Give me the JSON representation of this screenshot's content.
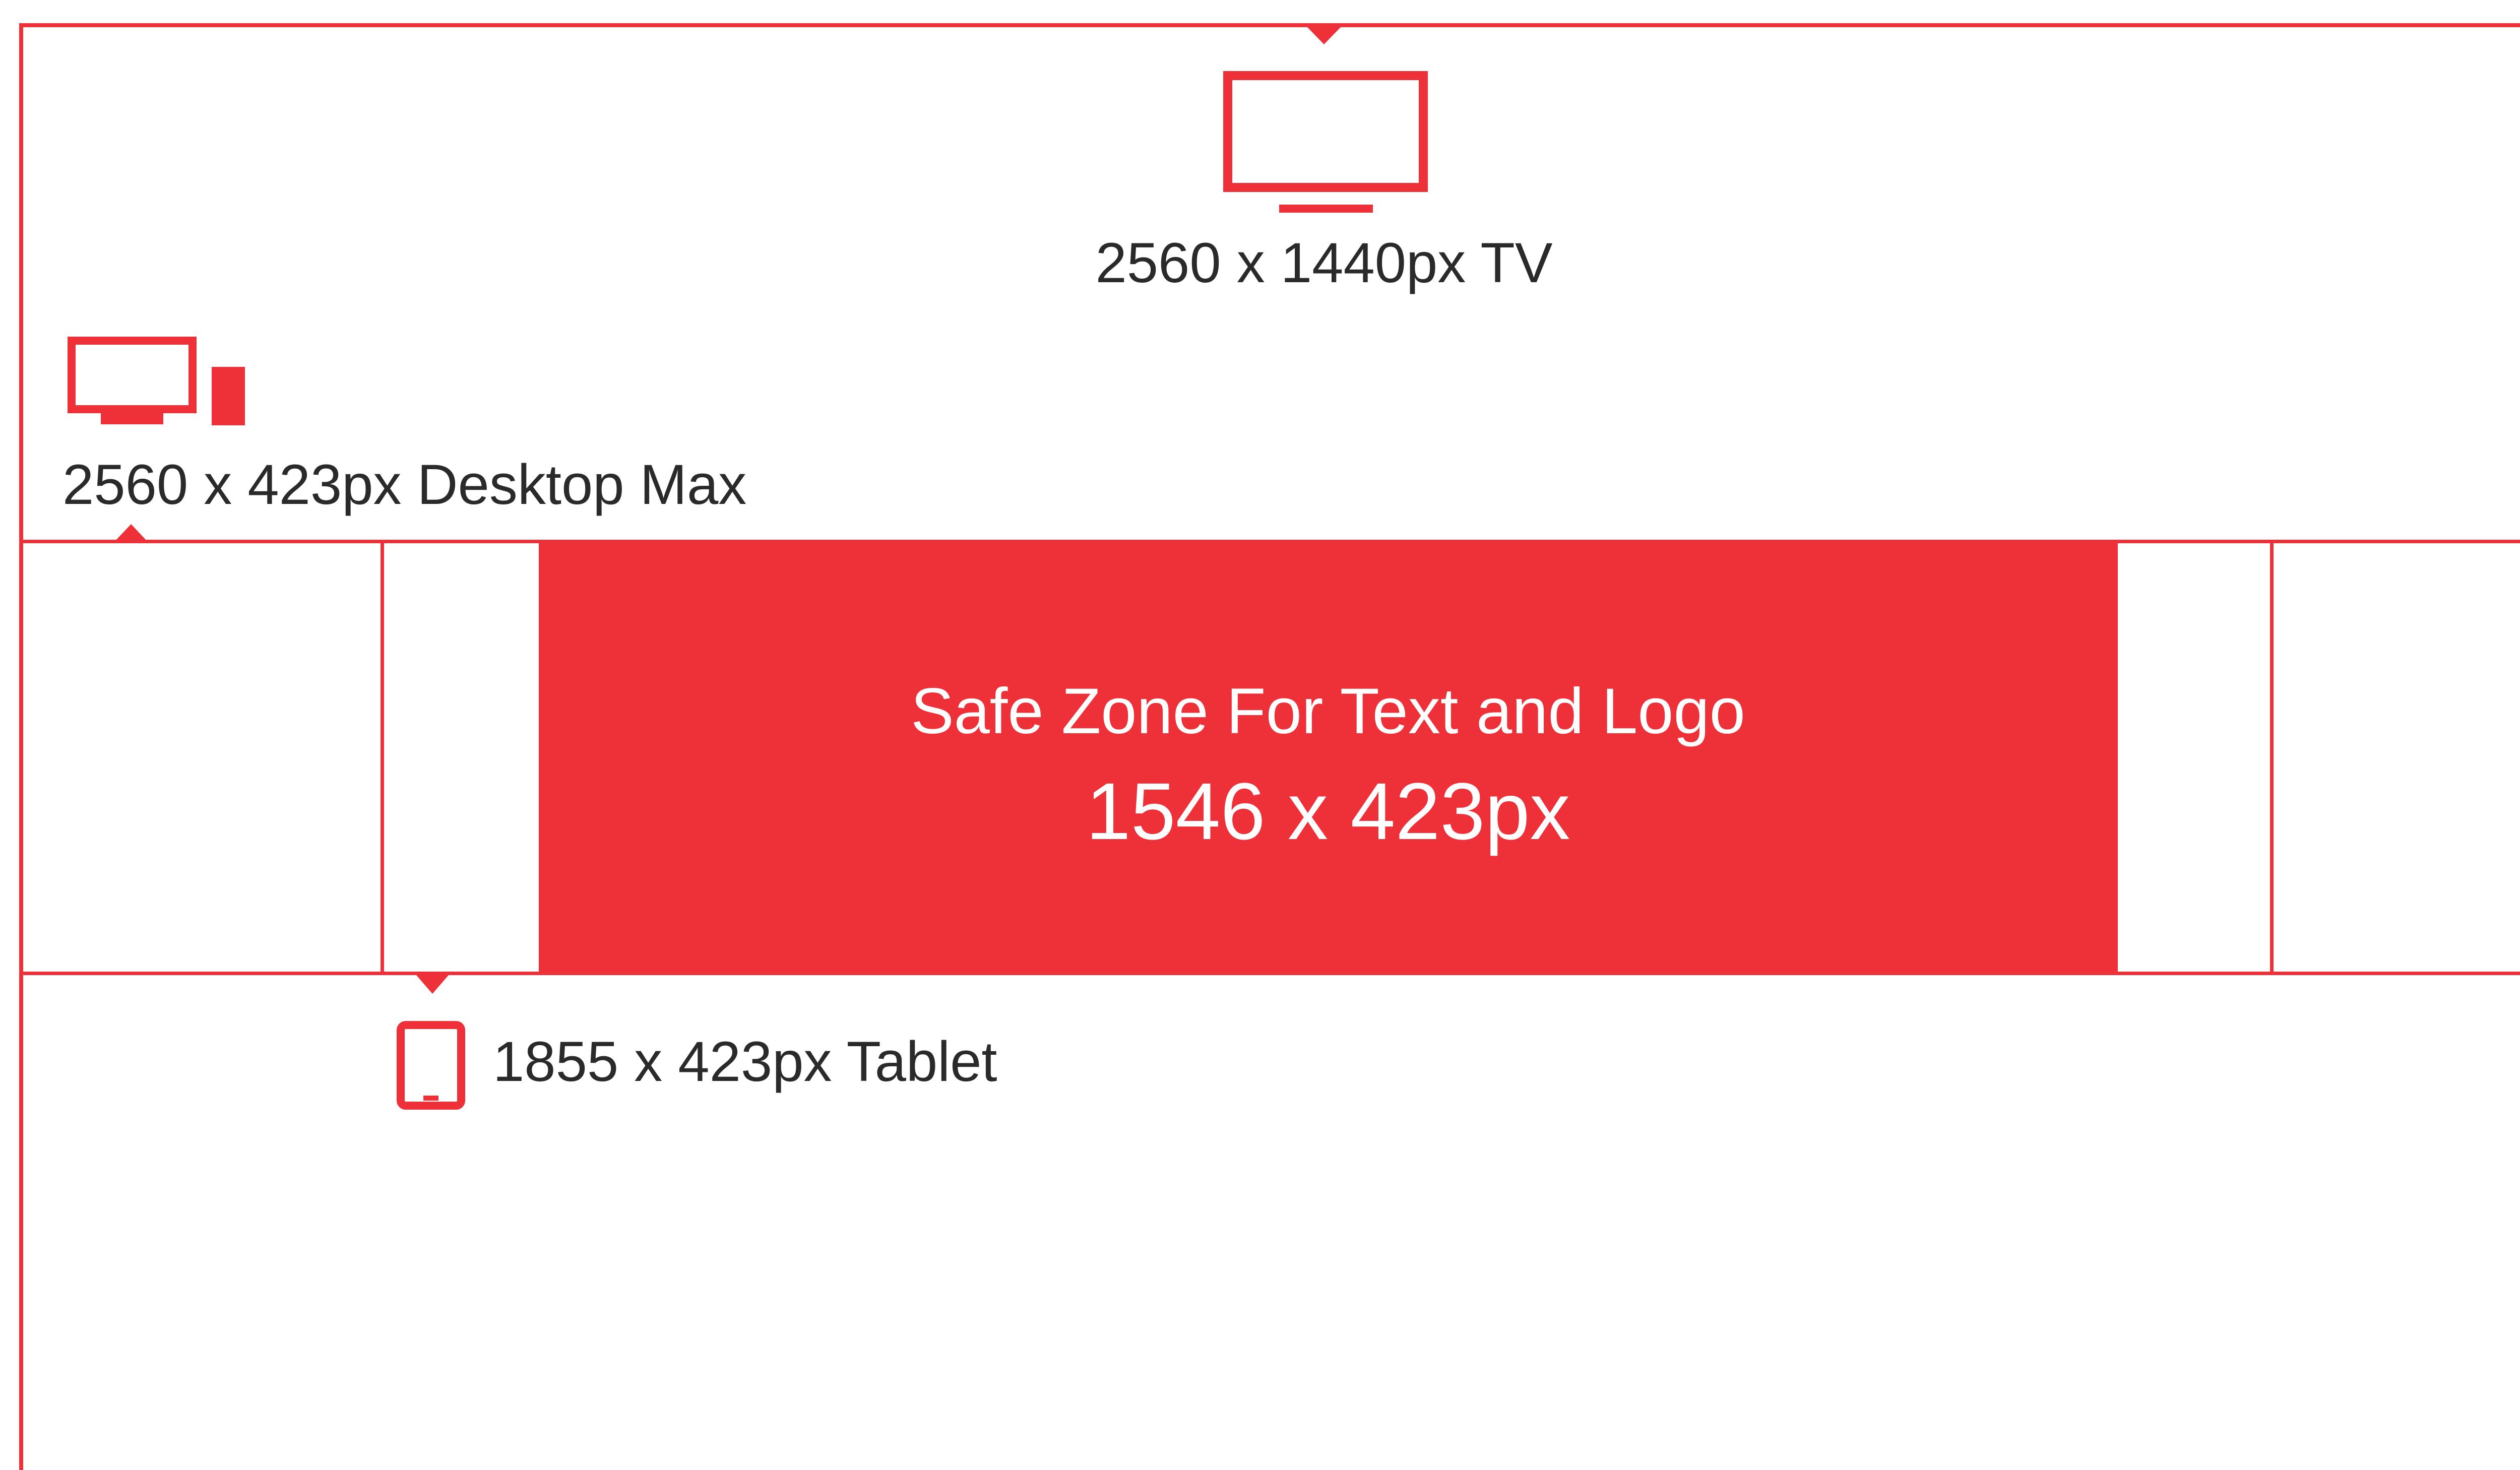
{
  "colors": {
    "accent": "#EE3038",
    "background": "#FFFFFF",
    "text": "#2A2A2A",
    "safe_zone_text": "#FFFFFF"
  },
  "labels": {
    "tv": "2560 x 1440px  TV",
    "desktop": "2560 x 423px  Desktop Max",
    "tablet": "1855 x 423px  Tablet",
    "safe_zone_title": "Safe Zone For Text and Logo",
    "safe_zone_size": "1546 x 423px"
  },
  "icons": {
    "tv": "tv-monitor-icon",
    "desktop": "desktop-and-phone-icon",
    "tablet": "tablet-icon"
  }
}
